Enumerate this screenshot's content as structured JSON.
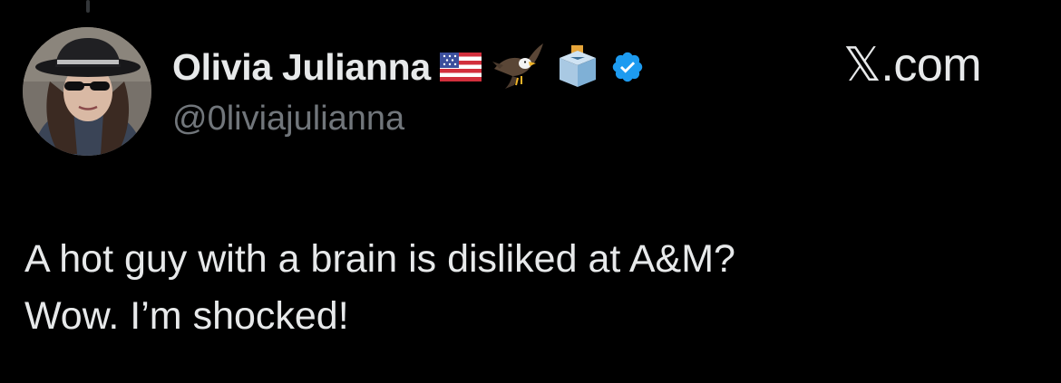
{
  "author": {
    "display_name": "Olivia Julianna",
    "handle": "@0liviajulianna",
    "name_emojis": [
      "us-flag-icon",
      "eagle-icon",
      "ballot-box-icon"
    ],
    "verified": true,
    "verified_color": "#1d9bf0"
  },
  "brand": {
    "label": "𝕏.com"
  },
  "tweet": {
    "lines": [
      "A hot guy with a brain is disliked at A&M?",
      "Wow. I’m shocked!"
    ]
  },
  "colors": {
    "background": "#000000",
    "text": "#e7e9ea",
    "secondary": "#71767b"
  }
}
